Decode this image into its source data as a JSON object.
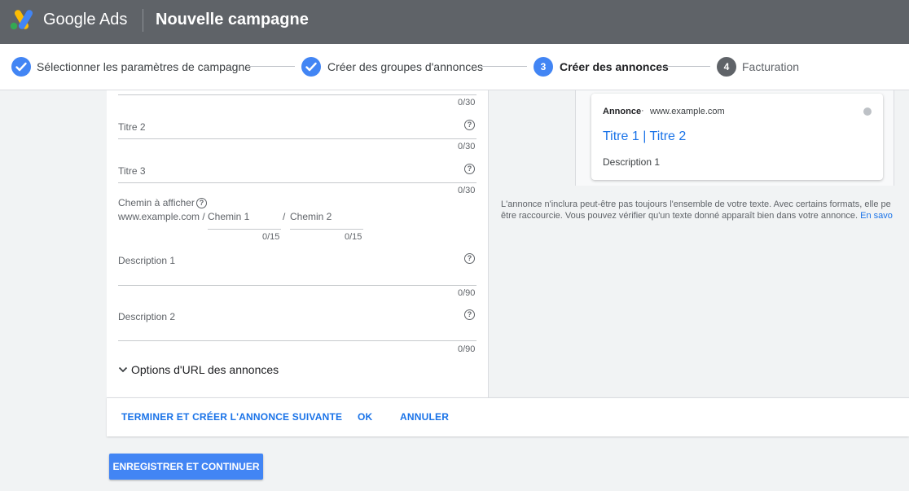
{
  "header": {
    "brand": "Google Ads",
    "campaign_title": "Nouvelle campagne"
  },
  "stepper": {
    "steps": [
      {
        "label": "Sélectionner les paramètres de campagne",
        "status": "done"
      },
      {
        "label": "Créer des groupes d'annonces",
        "status": "done"
      },
      {
        "number": "3",
        "label": "Créer des annonces",
        "status": "active"
      },
      {
        "number": "4",
        "label": "Facturation",
        "status": "pending"
      }
    ]
  },
  "form": {
    "headline1_counter": "0/30",
    "headline2": {
      "placeholder": "Titre 2",
      "counter": "0/30"
    },
    "headline3": {
      "placeholder": "Titre 3",
      "counter": "0/30"
    },
    "display_path": {
      "label": "Chemin à afficher",
      "domain": "www.example.com /",
      "path1_placeholder": "Chemin 1",
      "path1_counter": "0/15",
      "separator": "/",
      "path2_placeholder": "Chemin 2",
      "path2_counter": "0/15"
    },
    "description1": {
      "placeholder": "Description 1",
      "counter": "0/90"
    },
    "description2": {
      "placeholder": "Description 2",
      "counter": "0/90"
    },
    "url_options_label": "Options d'URL des annonces",
    "help_glyph": "?"
  },
  "actions": {
    "finish_and_next": "TERMINER ET CRÉER L'ANNONCE SUIVANTE",
    "ok": "OK",
    "cancel": "ANNULER",
    "save_continue": "ENREGISTRER ET CONTINUER"
  },
  "preview": {
    "badge": "Annonce",
    "bullet": "·",
    "url": "www.example.com",
    "headline": "Titre 1 | Titre 2",
    "description": "Description 1",
    "disclaimer_line1": "L'annonce n'inclura peut-être pas toujours l'ensemble de votre texte. Avec certains formats, elle pe",
    "disclaimer_line2": "être raccourcie. Vous pouvez vérifier qu'un texte donné apparaît bien dans votre annonce.",
    "disclaimer_link": "En savo"
  },
  "colors": {
    "topbar": "#5f6368",
    "accent": "#4285f4",
    "link": "#1a73e8",
    "background": "#f1f3f4"
  },
  "icons": {
    "logo": "google-ads-logo",
    "step_done": "check-icon",
    "help": "help-circle-icon",
    "expand": "chevron-down-icon",
    "menu": "more-dot-icon"
  }
}
